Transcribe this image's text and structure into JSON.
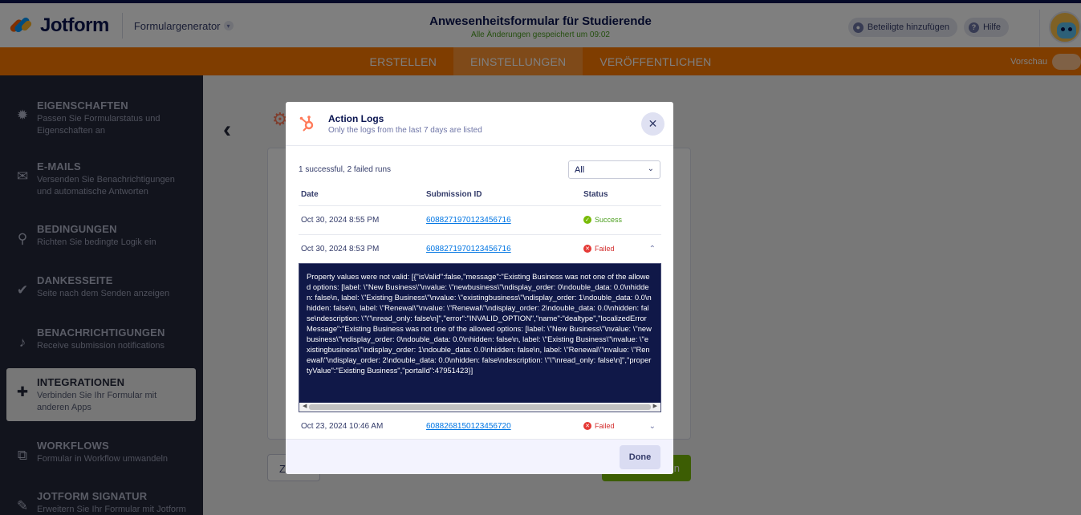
{
  "header": {
    "brand": "Jotform",
    "form_generator": "Formulargenerator",
    "form_title": "Anwesenheitsformular für Studierende",
    "save_status": "Alle Änderungen gespeichert um 09:02",
    "add_participants": "Beteiligte hinzufügen",
    "help": "Hilfe"
  },
  "nav": {
    "tabs": [
      "ERSTELLEN",
      "EINSTELLUNGEN",
      "VERÖFFENTLICHEN"
    ],
    "active_tab": "EINSTELLUNGEN",
    "preview_label": "Vorschau"
  },
  "sidebar": {
    "items": [
      {
        "title": "EIGENSCHAFTEN",
        "desc1": "Passen Sie Formularstatus und",
        "desc2": "Eigenschaften an",
        "icon": "gear-icon"
      },
      {
        "title": "E-MAILS",
        "desc1": "Versenden Sie Benachrichtigungen",
        "desc2": "und automatische Antworten",
        "icon": "envelope-icon"
      },
      {
        "title": "BEDINGUNGEN",
        "desc1": "Richten Sie bedingte Logik ein",
        "desc2": "",
        "icon": "sitemap-icon"
      },
      {
        "title": "DANKESSEITE",
        "desc1": "Seite nach dem Senden anzeigen",
        "desc2": "",
        "icon": "check-circle-icon"
      },
      {
        "title": "BENACHRICHTIGUNGEN",
        "desc1": "Receive submission notifications",
        "desc2": "",
        "icon": "bell-icon"
      },
      {
        "title": "INTEGRATIONEN",
        "desc1": "Verbinden Sie Ihr Formular mit",
        "desc2": "anderen Apps",
        "icon": "puzzle-icon"
      },
      {
        "title": "WORKFLOWS",
        "desc1": "Formular in Workflow umwandeln",
        "desc2": "",
        "icon": "workflow-icon"
      },
      {
        "title": "JOTFORM SIGNATUR",
        "desc1": "Erweitern Sie Ihr Formular mit Jotform",
        "desc2": "",
        "icon": "pen-icon"
      }
    ]
  },
  "background": {
    "left_button_peek": "Z",
    "right_button_peek": "n"
  },
  "modal": {
    "title": "Action Logs",
    "subtitle": "Only the logs from the last 7 days are listed",
    "runs_summary": "1 successful, 2 failed runs",
    "filter_value": "All",
    "columns": {
      "date": "Date",
      "submission": "Submission ID",
      "status": "Status"
    },
    "rows": [
      {
        "date": "Oct 30, 2024 8:55 PM",
        "submission_id": "6088271970123456716",
        "status": "Success"
      },
      {
        "date": "Oct 30, 2024 8:53 PM",
        "submission_id": "6088271970123456716",
        "status": "Failed"
      },
      {
        "date": "Oct 23, 2024 10:46 AM",
        "submission_id": "6088268150123456720",
        "status": "Failed"
      }
    ],
    "error_text": "Property values were not valid: [{\"isValid\":false,\"message\":\"Existing Business was not one of the allowed options: [label: \\\"New Business\\\"\\nvalue: \\\"newbusiness\\\"\\ndisplay_order: 0\\ndouble_data: 0.0\\nhidden: false\\n, label: \\\"Existing Business\\\"\\nvalue: \\\"existingbusiness\\\"\\ndisplay_order: 1\\ndouble_data: 0.0\\nhidden: false\\n, label: \\\"Renewal\\\"\\nvalue: \\\"Renewal\\\"\\ndisplay_order: 2\\ndouble_data: 0.0\\nhidden: false\\ndescription: \\\"\\\"\\nread_only: false\\n]\",\"error\":\"INVALID_OPTION\",\"name\":\"dealtype\",\"localizedErrorMessage\":\"Existing Business was not one of the allowed options: [label: \\\"New Business\\\"\\nvalue: \\\"newbusiness\\\"\\ndisplay_order: 0\\ndouble_data: 0.0\\nhidden: false\\n, label: \\\"Existing Business\\\"\\nvalue: \\\"existingbusiness\\\"\\ndisplay_order: 1\\ndouble_data: 0.0\\nhidden: false\\n, label: \\\"Renewal\\\"\\nvalue: \\\"Renewal\\\"\\ndisplay_order: 2\\ndouble_data: 0.0\\nhidden: false\\ndescription: \\\"\\\"\\nread_only: false\\n]\",\"propertyValue\":\"Existing Business\",\"portalId\":47951423}]",
    "done_label": "Done"
  },
  "colors": {
    "nav_orange": "#ff7a00",
    "sidebar_bg": "#24283b",
    "error_bg": "#101848",
    "success": "#78bb07",
    "failed": "#e53935",
    "hubspot": "#ff7a59"
  }
}
